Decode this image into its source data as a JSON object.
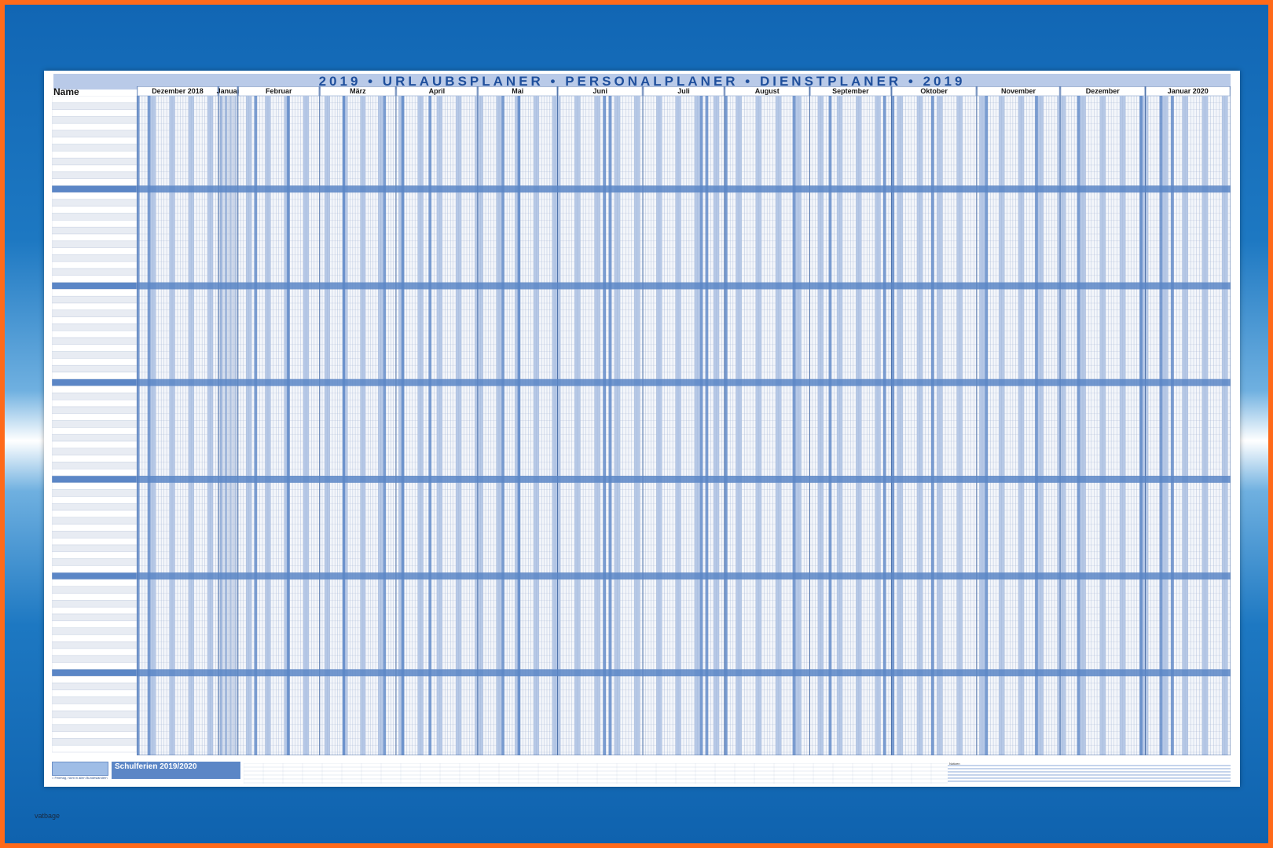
{
  "poster": {
    "title": "2019 • URLAUBSPLANER • PERSONALPLANER • DIENSTPLANER • 2019",
    "name_label": "Name",
    "months": [
      "Dezember 2018",
      "Januar",
      "Februar",
      "März",
      "April",
      "Mai",
      "Juni",
      "Juli",
      "August",
      "September",
      "Oktober",
      "November",
      "Dezember",
      "Januar 2020"
    ],
    "ferien_title": "Schulferien 2019/2020",
    "legend_text": "= Feiertag, nicht in allen Bundesländern",
    "notes_label": "Notizen"
  },
  "colors": {
    "accent": "#5b86c6",
    "header_band": "#b9cae8",
    "title_text": "#1f4f9c",
    "border_orange": "#ff6a1a",
    "background_blue": "#1166b4"
  },
  "watermark": "vatbage"
}
